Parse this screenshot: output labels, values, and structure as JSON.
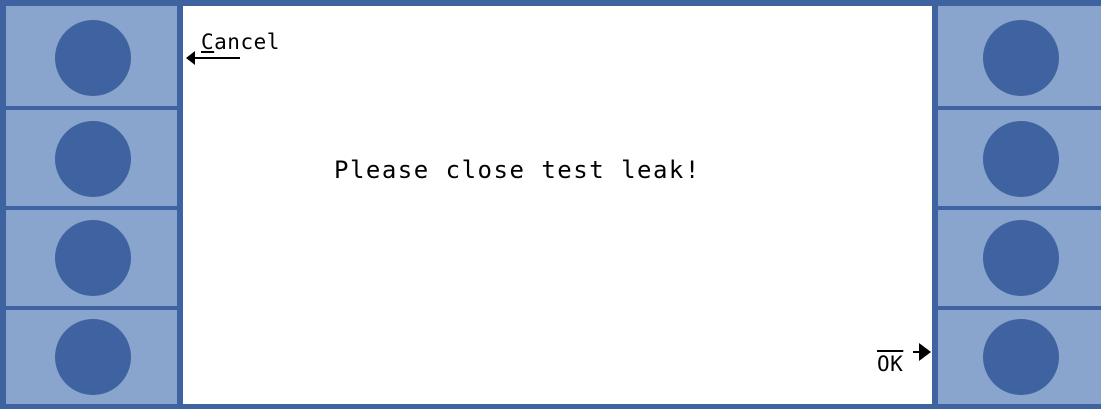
{
  "dialog": {
    "cancel_first": "C",
    "cancel_rest": "ancel",
    "message": "Please close test leak!",
    "ok_label": "OK"
  },
  "softkeys": {
    "left": [
      "left-softkey-1",
      "left-softkey-2",
      "left-softkey-3",
      "left-softkey-4"
    ],
    "right": [
      "right-softkey-1",
      "right-softkey-2",
      "right-softkey-3",
      "right-softkey-4"
    ]
  },
  "colors": {
    "bezel": "#3f62a0",
    "softkey_panel": "#8aa5cd",
    "softkey_dot": "#3f62a0",
    "screen": "#ffffff"
  }
}
